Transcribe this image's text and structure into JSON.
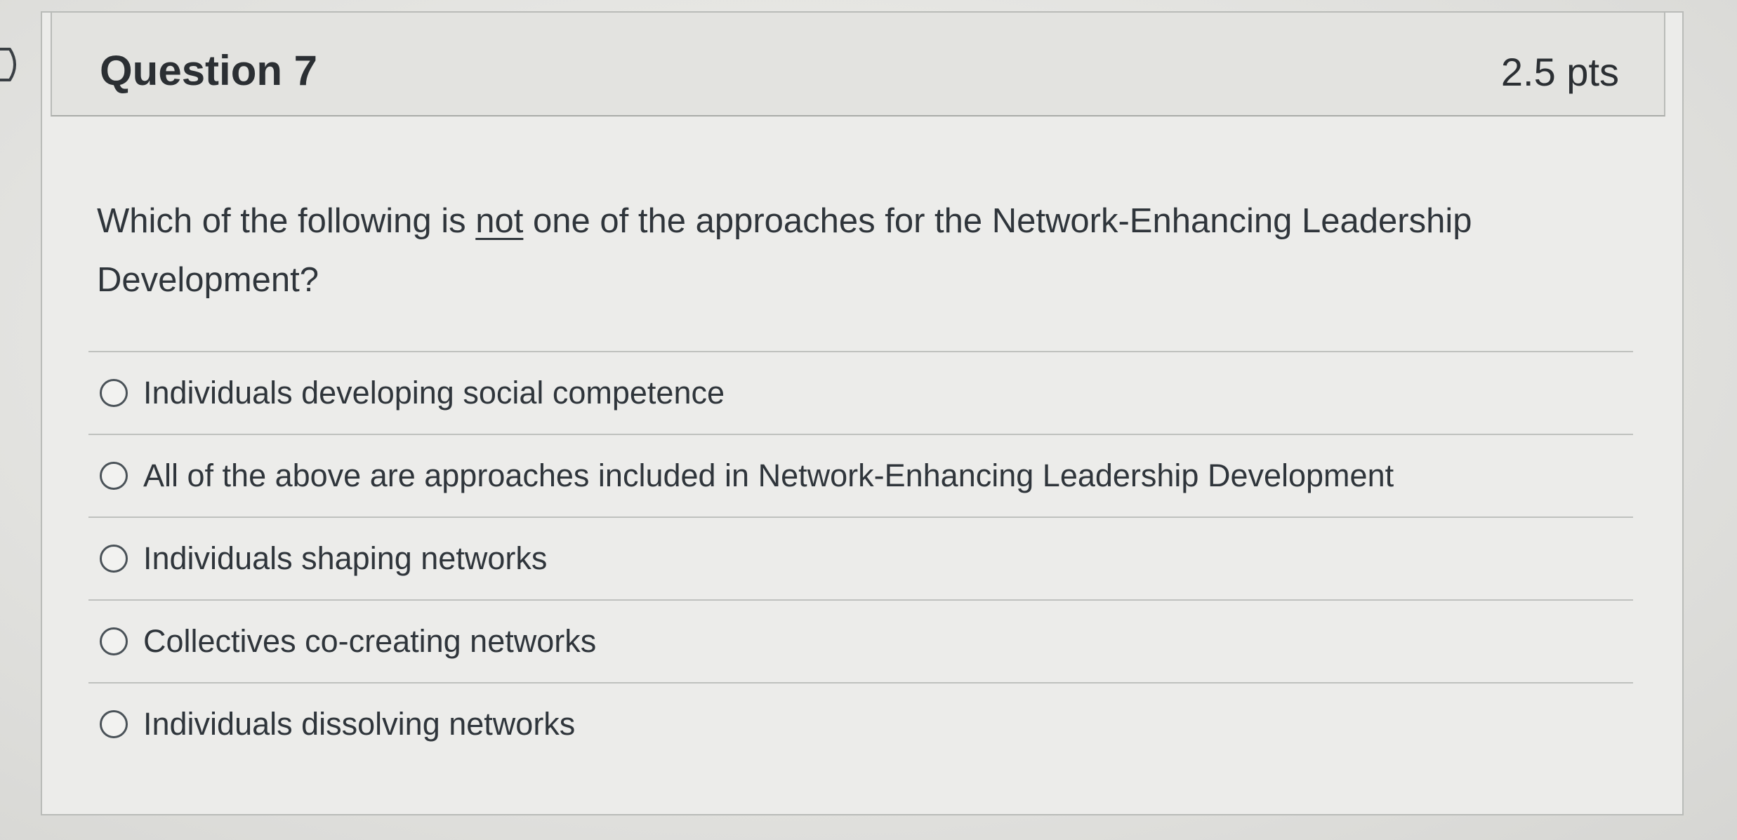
{
  "question": {
    "title": "Question 7",
    "points": "2.5 pts",
    "text_before": "Which of the following is ",
    "text_emphasis": "not",
    "text_after": " one of the approaches for the Network-Enhancing Leadership Development?"
  },
  "answers": [
    {
      "label": "Individuals developing social competence"
    },
    {
      "label": "All of the above are approaches included in Network-Enhancing Leadership Development"
    },
    {
      "label": "Individuals shaping networks"
    },
    {
      "label": "Collectives co-creating networks"
    },
    {
      "label": "Individuals dissolving networks"
    }
  ],
  "icons": {
    "nav": "chevron-right-icon",
    "radio": "radio-unchecked-icon"
  },
  "colors": {
    "text": "#2f353b",
    "border": "#bfc1be",
    "header_bg": "#e3e3e0"
  }
}
